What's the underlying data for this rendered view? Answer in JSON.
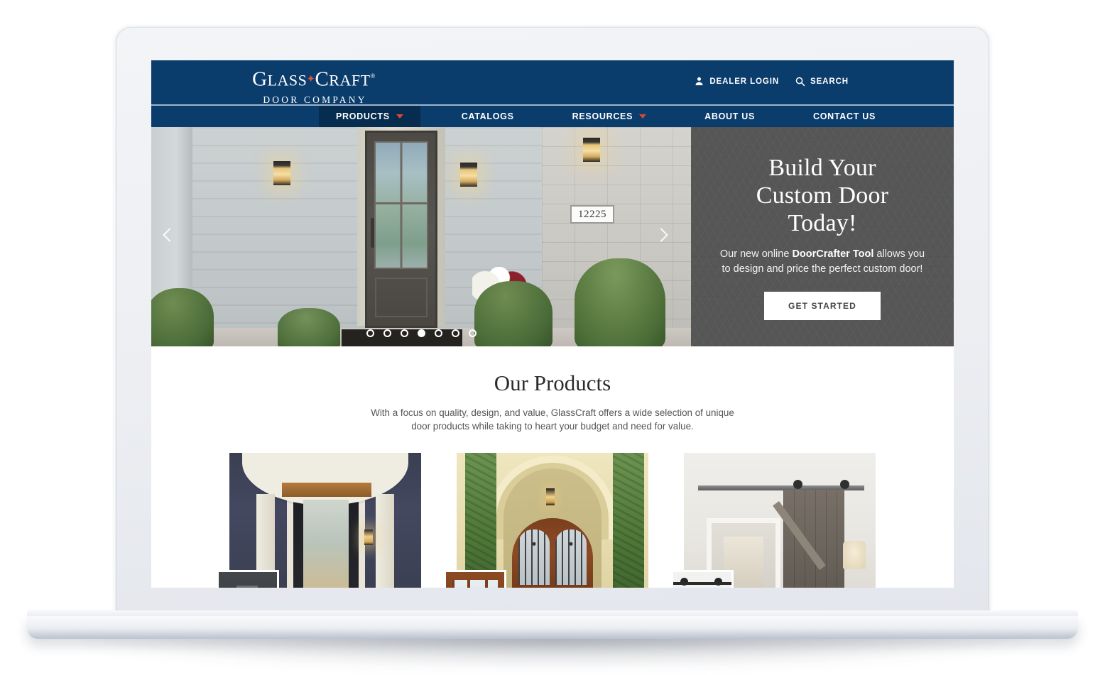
{
  "brand": {
    "logo_line1_a": "G",
    "logo_line1_b": "LASS",
    "logo_line1_c": "C",
    "logo_line1_d": "RAFT",
    "logo_reg": "®",
    "logo_line2": "DOOR COMPANY",
    "star_icon": "star-icon"
  },
  "header": {
    "dealer_login": "DEALER LOGIN",
    "search": "SEARCH",
    "dealer_icon": "person-icon",
    "search_icon": "search-icon"
  },
  "nav": {
    "items": [
      {
        "label": "PRODUCTS",
        "has_caret": true,
        "active": true
      },
      {
        "label": "CATALOGS",
        "has_caret": false,
        "active": false
      },
      {
        "label": "RESOURCES",
        "has_caret": true,
        "active": false
      },
      {
        "label": "ABOUT US",
        "has_caret": false,
        "active": false
      },
      {
        "label": "CONTACT US",
        "has_caret": false,
        "active": false
      }
    ]
  },
  "hero": {
    "prev_icon": "chevron-left-icon",
    "next_icon": "chevron-right-icon",
    "house_number": "12225",
    "title_line1": "Build Your",
    "title_line2": "Custom Door",
    "title_line3": "Today!",
    "sub_pre": "Our new online ",
    "sub_bold": "DoorCrafter Tool",
    "sub_post": " allows you to design and price the perfect custom door!",
    "cta": "GET STARTED",
    "slide_count": 7,
    "active_slide": 4
  },
  "products": {
    "title": "Our Products",
    "description": "With a focus on quality, design, and value, GlassCraft offers a wide selection of unique door products while taking to heart your budget and need for value.",
    "cards": [
      {
        "name": "exterior-entry-doors"
      },
      {
        "name": "wrought-iron-doors"
      },
      {
        "name": "barn-doors"
      }
    ]
  },
  "colors": {
    "brand_blue": "#0a3c6c",
    "nav_active": "#062c50",
    "accent_red": "#d9482f",
    "hero_panel_grey": "#565656",
    "cta_white": "#ffffff"
  }
}
